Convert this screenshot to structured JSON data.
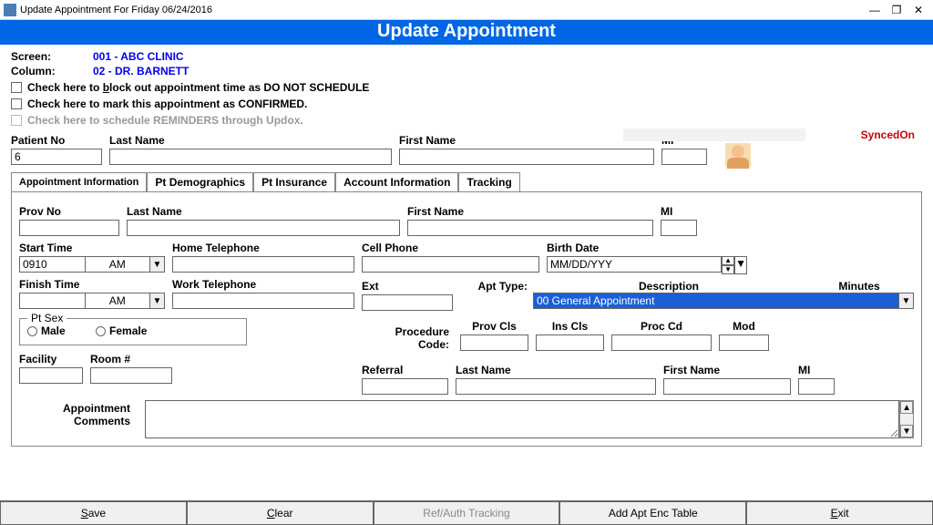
{
  "window": {
    "title": "Update Appointment For Friday 06/24/2016"
  },
  "header": "Update Appointment",
  "screen_label": "Screen:",
  "screen_value": "001 - ABC CLINIC",
  "column_label": "Column:",
  "column_value": "02 - DR. BARNETT",
  "check1": "Check here to block out appointment time as DO NOT SCHEDULE",
  "check2": "Check here to mark this appointment as CONFIRMED.",
  "check3": "Check here to schedule REMINDERS through Updox.",
  "synced": "SyncedOn",
  "patient_no_label": "Patient No",
  "patient_no_value": "6",
  "last_name_label": "Last Name",
  "first_name_label": "First Name",
  "mi_label": "MI",
  "tabs": {
    "t1": "Appointment Information",
    "t2": "Pt Demographics",
    "t3": "Pt Insurance",
    "t4": "Account Information",
    "t5": "Tracking"
  },
  "prov_no": "Prov No",
  "start_time": "Start Time",
  "start_val": "0910",
  "ampm": "AM",
  "finish_time": "Finish Time",
  "home_tel": "Home Telephone",
  "work_tel": "Work Telephone",
  "cell": "Cell Phone",
  "ext": "Ext",
  "birth": "Birth Date",
  "birth_val": "MM/DD/YYY",
  "apt_type": "Apt Type:",
  "description": "Description",
  "minutes": "Minutes",
  "apt_value": "00 General Appointment",
  "proc_code": "Procedure Code:",
  "prov_cls": "Prov Cls",
  "ins_cls": "Ins Cls",
  "proc_cd": "Proc Cd",
  "mod": "Mod",
  "pt_sex": "Pt Sex",
  "male": "Male",
  "female": "Female",
  "facility": "Facility",
  "room": "Room #",
  "referral": "Referral",
  "appt_comments": "Appointment Comments",
  "buttons": {
    "save": "Save",
    "clear": "Clear",
    "ref": "Ref/Auth Tracking",
    "add": "Add Apt Enc Table",
    "exit": "Exit"
  }
}
